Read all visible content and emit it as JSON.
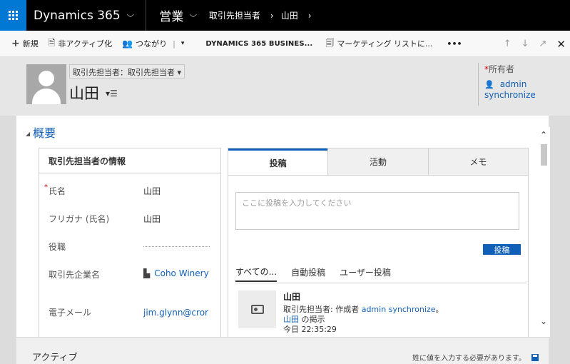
{
  "topnav": {
    "brand": "Dynamics 365",
    "area": "営業",
    "breadcrumb_entity": "取引先担当者",
    "breadcrumb_record": "山田"
  },
  "commandbar": {
    "new": "新規",
    "deactivate": "非アクティブ化",
    "connect": "つながり",
    "business": "DYNAMICS 365 BUSINES...",
    "marketing": "マーケティング リストに...",
    "more": "•••"
  },
  "header": {
    "form_selector": "取引先担当者：取引先担当者 ▾",
    "record_name": "山田",
    "owner_label": "所有者",
    "owner_value": "admin synchronize"
  },
  "section": {
    "title": "概要"
  },
  "contact_info": {
    "heading": "取引先担当者の情報",
    "fields": [
      {
        "label": "氏名",
        "value": "山田",
        "required": true
      },
      {
        "label": "フリガナ (氏名)",
        "value": "山田"
      },
      {
        "label": "役職",
        "value": ""
      },
      {
        "label": "取引先企業名",
        "value": "Coho Winery"
      },
      {
        "label": "電子メール",
        "value": "jim.glynn@cror"
      }
    ]
  },
  "posts": {
    "tabs": [
      "投稿",
      "活動",
      "メモ"
    ],
    "placeholder": "ここに投稿を入力してください",
    "post_button": "投稿",
    "subtabs": [
      "すべての...",
      "自動投稿",
      "ユーザー投稿"
    ],
    "item": {
      "title": "山田",
      "line1_prefix": "取引先担当者: 作成者 ",
      "line1_link": "admin synchronize",
      "line1_suffix": "。",
      "line2_link": "山田",
      "line2_suffix": " の掲示",
      "timestamp": "今日 22:35:29"
    }
  },
  "footer": {
    "status": "アクティブ",
    "message": "姓に値を入力する必要があります。"
  }
}
